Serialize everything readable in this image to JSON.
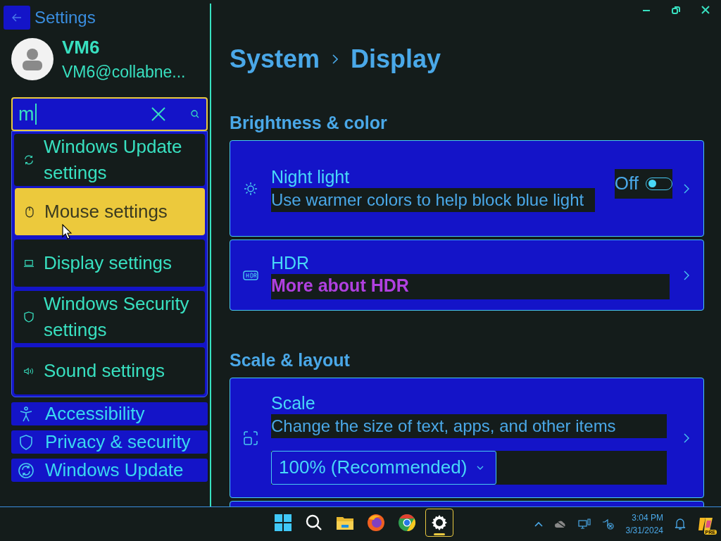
{
  "window": {
    "title": "Settings"
  },
  "account": {
    "name": "VM6",
    "email": "VM6@collabne..."
  },
  "search": {
    "value": "m"
  },
  "suggestions": [
    {
      "label": "Windows Update settings",
      "selected": false
    },
    {
      "label": "Mouse settings",
      "selected": true
    },
    {
      "label": "Display settings",
      "selected": false
    },
    {
      "label": "Windows Security settings",
      "selected": false
    },
    {
      "label": "Sound settings",
      "selected": false
    }
  ],
  "nav": [
    {
      "label": "Accessibility"
    },
    {
      "label": "Privacy & security"
    },
    {
      "label": "Windows Update"
    }
  ],
  "breadcrumb": [
    "System",
    "Display"
  ],
  "sections": [
    {
      "title": "Brightness & color",
      "cards": [
        {
          "kind": "toggle",
          "title": "Night light",
          "description": "Use warmer colors to help block blue light",
          "state_label": "Off",
          "on": false
        },
        {
          "kind": "link",
          "title": "HDR",
          "link": "More about HDR"
        }
      ]
    },
    {
      "title": "Scale & layout",
      "cards": [
        {
          "kind": "dropdown",
          "title": "Scale",
          "description": "Change the size of text, apps, and other items",
          "value": "100% (Recommended)"
        },
        {
          "kind": "partial"
        }
      ]
    }
  ],
  "taskbar": {
    "time": "3:04 PM",
    "date": "3/31/2024",
    "badge": "PRE"
  }
}
